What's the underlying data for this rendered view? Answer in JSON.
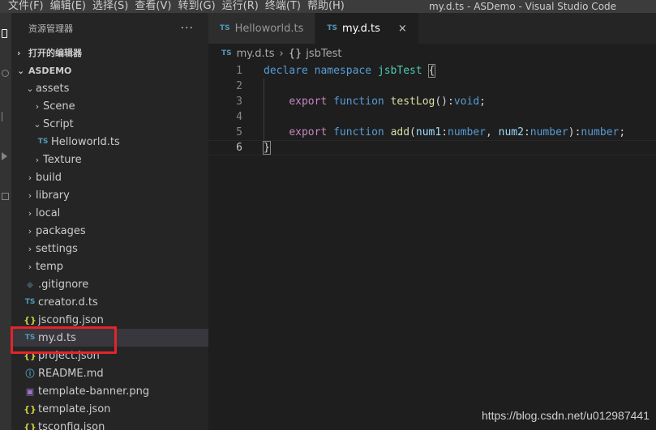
{
  "menu": [
    "文件(F)",
    "编辑(E)",
    "选择(S)",
    "查看(V)",
    "转到(G)",
    "运行(R)",
    "终端(T)",
    "帮助(H)"
  ],
  "window_title": "my.d.ts - ASDemo - Visual Studio Code",
  "sidebar": {
    "title": "资源管理器",
    "more": "···",
    "open_editors": "打开的编辑器",
    "project": "ASDEMO",
    "tree": {
      "assets": "assets",
      "scene": "Scene",
      "script": "Script",
      "helloworld": "Helloworld.ts",
      "texture": "Texture",
      "build": "build",
      "library": "library",
      "local": "local",
      "packages": "packages",
      "settings": "settings",
      "temp": "temp",
      "gitignore": ".gitignore",
      "creator": "creator.d.ts",
      "jsconfig": "jsconfig.json",
      "myd": "my.d.ts",
      "project": "project.json",
      "readme": "README.md",
      "banner": "template-banner.png",
      "template": "template.json",
      "tsconfig": "tsconfig.json"
    }
  },
  "icons": {
    "ts": "TS",
    "json": "{}",
    "chevron_right": "›",
    "chevron_down": "⌄"
  },
  "tabs": [
    {
      "label": "Helloworld.ts",
      "active": false
    },
    {
      "label": "my.d.ts",
      "active": true
    }
  ],
  "tab_close": "×",
  "breadcrumb": {
    "file": "my.d.ts",
    "sep": "›",
    "ns_icon": "{}",
    "symbol": "jsbTest"
  },
  "code": {
    "line_numbers": [
      "1",
      "2",
      "3",
      "4",
      "5",
      "6"
    ],
    "l1": {
      "declare": "declare",
      "namespace": "namespace",
      "name": "jsbTest",
      "brace": "{"
    },
    "l3": {
      "export": "export",
      "function": "function",
      "fn": "testLog",
      "rest": "():",
      "type": "void",
      "end": ";"
    },
    "l5": {
      "export": "export",
      "function": "function",
      "fn": "add",
      "open": "(",
      "p1": "num1",
      "c1": ":",
      "t1": "number",
      "comma": ", ",
      "p2": "num2",
      "c2": ":",
      "t2": "number",
      "close": "):",
      "rt": "number",
      "end": ";"
    },
    "l6": {
      "brace": "}"
    }
  },
  "watermark": "https://blog.csdn.net/u012987441",
  "colors": {
    "highlight_box": "#e3242b",
    "ts_icon": "#519aba",
    "json_icon": "#cbcb41"
  }
}
